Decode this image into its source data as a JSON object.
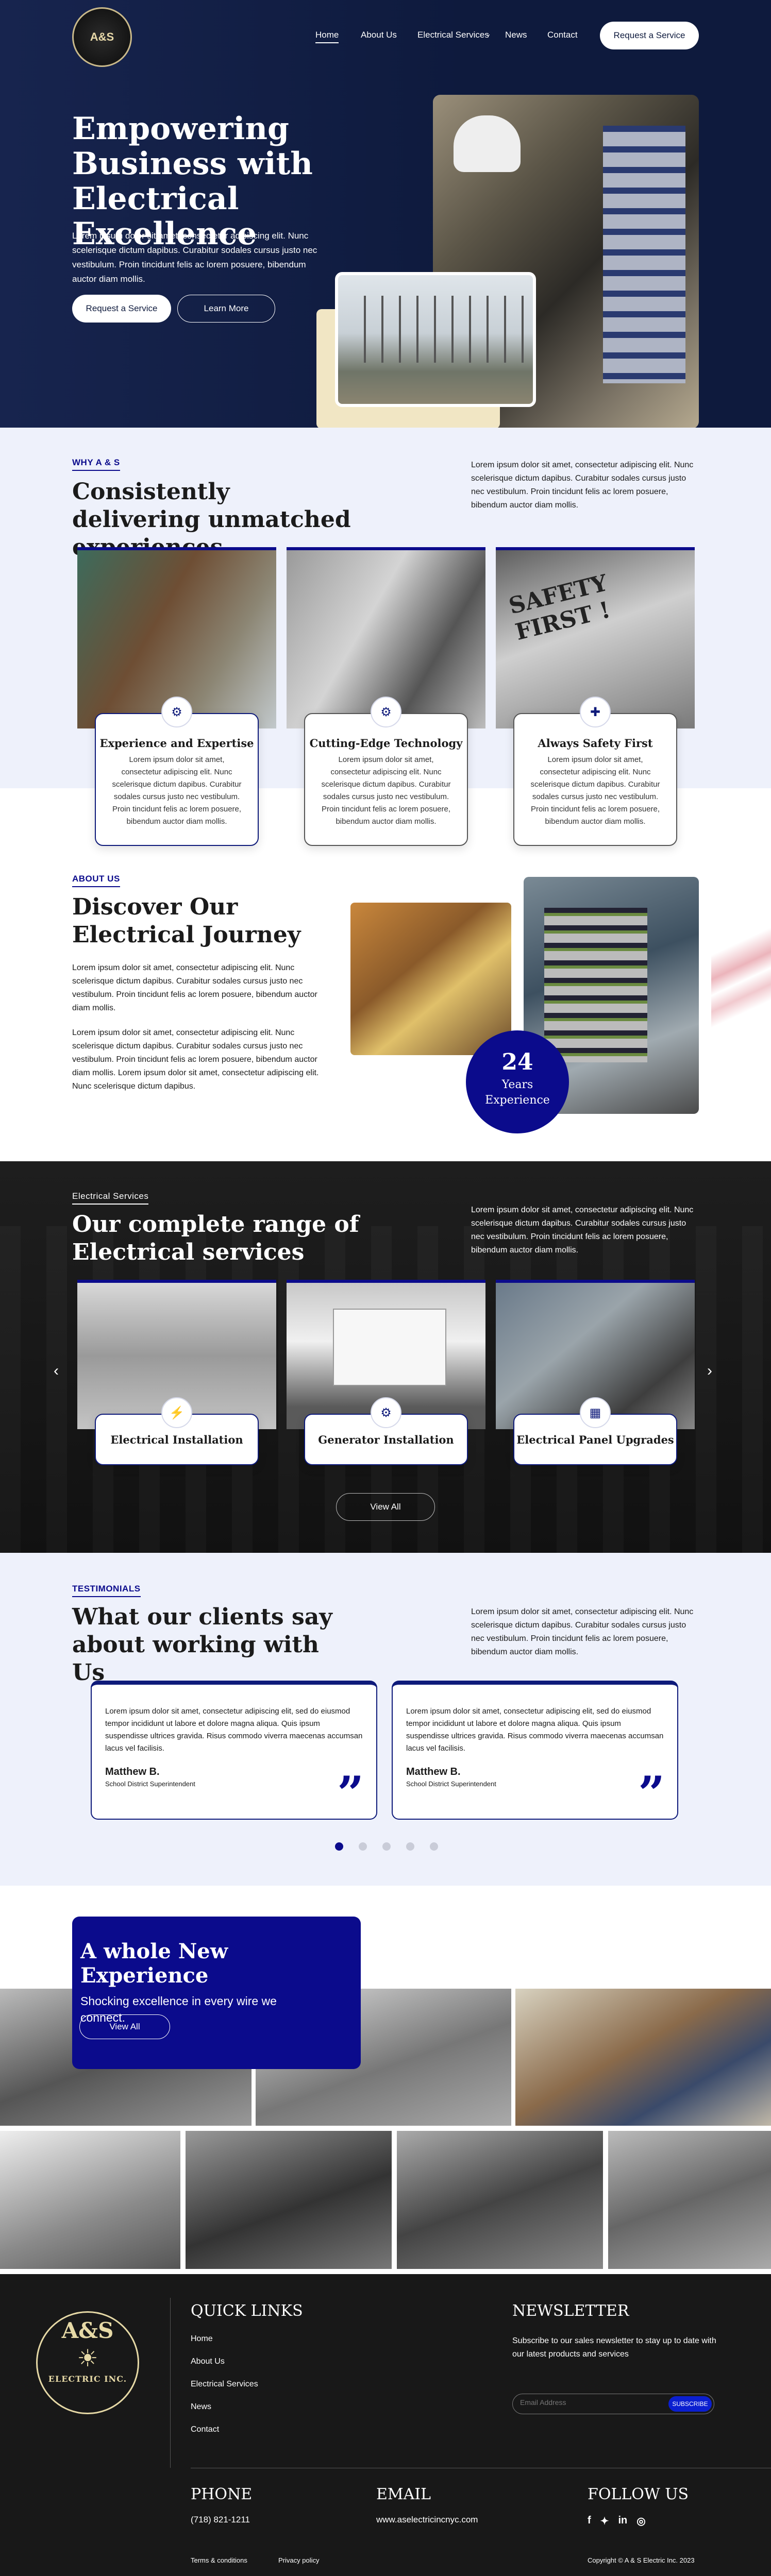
{
  "nav": {
    "logo_text": "A&S",
    "links": [
      "Home",
      "About Us",
      "Electrical Services",
      "News",
      "Contact"
    ],
    "cta": "Request a Service"
  },
  "hero": {
    "title": "Empowering Business with Electrical Excellence",
    "body": "Lorem ipsum dolor sit amet, consectetur adipiscing elit. Nunc scelerisque dictum dapibus. Curabitur sodales cursus justo nec vestibulum. Proin tincidunt felis ac lorem posuere, bibendum auctor diam mollis.",
    "btn_primary": "Request a Service",
    "btn_secondary": "Learn More"
  },
  "why": {
    "label": "WHY A & S",
    "title": "Consistently delivering unmatched experiences",
    "intro": "Lorem ipsum dolor sit amet, consectetur adipiscing elit. Nunc scelerisque dictum dapibus. Curabitur sodales cursus justo nec vestibulum. Proin tincidunt felis ac lorem posuere, bibendum auctor diam mollis.",
    "cards": [
      {
        "title": "Experience and Expertise",
        "body": "Lorem ipsum dolor sit amet, consectetur adipiscing elit. Nunc scelerisque dictum dapibus. Curabitur sodales cursus justo nec vestibulum. Proin tincidunt felis ac lorem posuere, bibendum auctor diam mollis."
      },
      {
        "title": "Cutting-Edge Technology",
        "body": "Lorem ipsum dolor sit amet, consectetur adipiscing elit. Nunc scelerisque dictum dapibus. Curabitur sodales cursus justo nec vestibulum. Proin tincidunt felis ac lorem posuere, bibendum auctor diam mollis."
      },
      {
        "title": "Always Safety First",
        "body": "Lorem ipsum dolor sit amet, consectetur adipiscing elit. Nunc scelerisque dictum dapibus. Curabitur sodales cursus justo nec vestibulum. Proin tincidunt felis ac lorem posuere, bibendum auctor diam mollis."
      }
    ]
  },
  "about": {
    "label": "ABOUT US",
    "title": "Discover Our Electrical Journey",
    "p1": "Lorem ipsum dolor sit amet, consectetur adipiscing elit. Nunc scelerisque dictum dapibus. Curabitur sodales cursus justo nec vestibulum. Proin tincidunt felis ac lorem posuere, bibendum auctor diam mollis.",
    "p2": "Lorem ipsum dolor sit amet, consectetur adipiscing elit. Nunc scelerisque dictum dapibus. Curabitur sodales cursus justo nec vestibulum. Proin tincidunt felis ac lorem posuere, bibendum auctor diam mollis. Lorem ipsum dolor sit amet, consectetur adipiscing elit. Nunc scelerisque dictum dapibus.",
    "badge_num": "24",
    "badge_text": "Years Experience"
  },
  "services": {
    "label": "Electrical Services",
    "title": "Our complete range of Electrical services",
    "intro": "Lorem ipsum dolor sit amet, consectetur adipiscing elit. Nunc scelerisque dictum dapibus. Curabitur sodales cursus justo nec vestibulum. Proin tincidunt felis ac lorem posuere, bibendum auctor diam mollis.",
    "items": [
      "Electrical Installation",
      "Generator Installation",
      "Electrical Panel Upgrades"
    ],
    "view_all": "View All"
  },
  "testimonials": {
    "label": "TESTIMONIALS",
    "title": "What our clients say about working with Us",
    "intro": "Lorem ipsum dolor sit amet, consectetur adipiscing elit. Nunc scelerisque dictum dapibus. Curabitur sodales cursus justo nec vestibulum. Proin tincidunt felis ac lorem posuere, bibendum auctor diam mollis.",
    "items": [
      {
        "quote": "Lorem ipsum dolor sit amet, consectetur adipiscing elit, sed do eiusmod tempor incididunt ut labore et dolore magna aliqua. Quis ipsum suspendisse ultrices gravida. Risus commodo viverra maecenas accumsan lacus vel facilisis.",
        "name": "Matthew B.",
        "role": "School District Superintendent"
      },
      {
        "quote": "Lorem ipsum dolor sit amet, consectetur adipiscing elit, sed do eiusmod tempor incididunt ut labore et dolore magna aliqua. Quis ipsum suspendisse ultrices gravida. Risus commodo viverra maecenas accumsan lacus vel facilisis.",
        "name": "Matthew B.",
        "role": "School District Superintendent"
      }
    ],
    "active_dot": 0
  },
  "gallery": {
    "title": "A whole New Experience",
    "subtitle": "Shocking excellence in every wire we connect.",
    "btn": "View All"
  },
  "footer": {
    "logo_top": "A&S",
    "logo_bottom": "ELECTRIC INC.",
    "quick_links_title": "QUICK LINKS",
    "quick_links": [
      "Home",
      "About Us",
      "Electrical Services",
      "News",
      "Contact"
    ],
    "newsletter_title": "NEWSLETTER",
    "newsletter_text": "Subscribe to our sales newsletter to stay up to date with our latest products and services",
    "email_placeholder": "Email Address",
    "subscribe": "SUBSCRIBE",
    "phone_title": "PHONE",
    "phone": "(718) 821-1211",
    "email_title": "EMAIL",
    "email": "www.aselectricincnyc.com",
    "follow_title": "FOLLOW US",
    "terms": "Terms & conditions",
    "privacy": "Privacy policy",
    "copyright": "Copyright © A & S Electric Inc. 2023"
  },
  "colors": {
    "navy": "#0e1a3d",
    "royal": "#0b0b8c",
    "dark": "#171717",
    "light": "#eef1fb"
  }
}
